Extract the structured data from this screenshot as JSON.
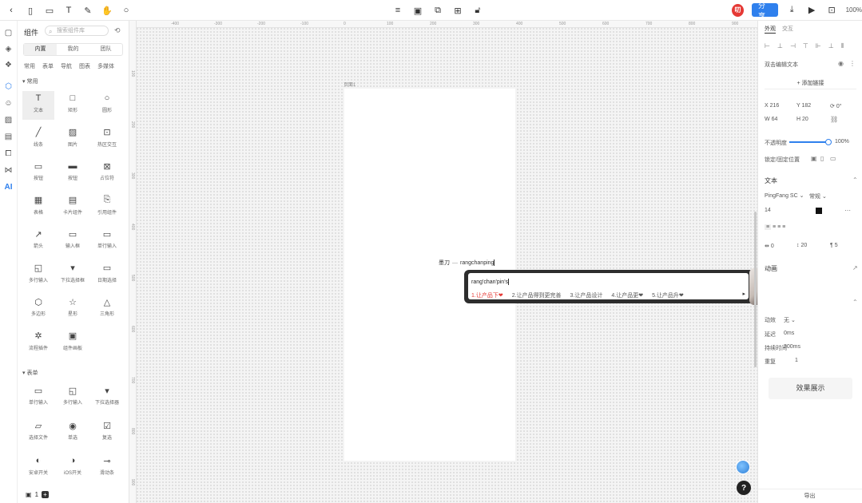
{
  "toolbar": {
    "zoom": "100%",
    "share_label": "分享",
    "avatar_text": "叨"
  },
  "left_panel": {
    "title": "组件",
    "search_placeholder": "搜索组件库",
    "segments": [
      "内置",
      "我的",
      "团队"
    ],
    "subtabs": [
      "常用",
      "表单",
      "导航",
      "图表",
      "多媒体"
    ],
    "group_basic": "▾ 常用",
    "group_form": "▾ 表单",
    "basic_items": [
      {
        "label": "文本",
        "icon": "text-icon"
      },
      {
        "label": "矩形",
        "icon": "rectangle-icon"
      },
      {
        "label": "圆形",
        "icon": "circle-icon"
      },
      {
        "label": "线条",
        "icon": "line-icon"
      },
      {
        "label": "图片",
        "icon": "image-icon"
      },
      {
        "label": "热区交互",
        "icon": "hotspot-icon"
      },
      {
        "label": "按钮",
        "icon": "button-icon"
      },
      {
        "label": "按钮",
        "icon": "button-filled-icon"
      },
      {
        "label": "占位符",
        "icon": "placeholder-icon"
      },
      {
        "label": "表格",
        "icon": "table-icon"
      },
      {
        "label": "卡片组件",
        "icon": "card-icon"
      },
      {
        "label": "引用组件",
        "icon": "reference-icon"
      },
      {
        "label": "箭头",
        "icon": "arrow-icon"
      },
      {
        "label": "输入框",
        "icon": "input-icon"
      },
      {
        "label": "单行输入",
        "icon": "single-input-icon"
      },
      {
        "label": "多行输入",
        "icon": "multiline-icon"
      },
      {
        "label": "下拉选择框",
        "icon": "dropdown-icon"
      },
      {
        "label": "日期选择",
        "icon": "date-icon"
      },
      {
        "label": "多边形",
        "icon": "polygon-icon"
      },
      {
        "label": "星形",
        "icon": "star-icon"
      },
      {
        "label": "三角形",
        "icon": "triangle-icon"
      },
      {
        "label": "流程插件",
        "icon": "pinwheel-icon"
      },
      {
        "label": "组件画板",
        "icon": "artboard-icon"
      }
    ],
    "form_items": [
      {
        "label": "单行输入",
        "icon": "single-input-icon"
      },
      {
        "label": "多行输入",
        "icon": "multiline-icon"
      },
      {
        "label": "下拉选择器",
        "icon": "dropdown-icon"
      },
      {
        "label": "选择文件",
        "icon": "folder-icon"
      },
      {
        "label": "单选",
        "icon": "radio-icon"
      },
      {
        "label": "复选",
        "icon": "checkbox-icon"
      },
      {
        "label": "安卓开关",
        "icon": "toggle-icon"
      },
      {
        "label": "iOS开关",
        "icon": "ios-toggle-icon"
      },
      {
        "label": "滑动条",
        "icon": "slider-icon"
      }
    ],
    "footer_count": "1"
  },
  "canvas": {
    "page_label": "页面1",
    "ruler_h": [
      "-400",
      "-300",
      "-200",
      "-100",
      "0",
      "100",
      "200",
      "300",
      "400",
      "500",
      "600",
      "700",
      "800",
      "900"
    ],
    "ruler_v": [
      "100",
      "200",
      "300",
      "400",
      "500",
      "600",
      "700",
      "800",
      "900"
    ],
    "text_prefix": "墨刀",
    "text_sep": "—",
    "text_typed": "rangchanping"
  },
  "ime": {
    "input": "rang'chan'pin's",
    "candidates": [
      "1.让产品下❤",
      "2.让产品得到更完善",
      "3.让产品设计",
      "4.让产品更❤",
      "5.让产品升❤"
    ],
    "next": "▸"
  },
  "inspector": {
    "tabs": [
      "外观",
      "交互"
    ],
    "section_rich": "双击编辑文本",
    "link_btn": "+ 添加链接",
    "x_label": "X",
    "x_val": "216",
    "y_label": "Y",
    "y_val": "182",
    "rot_val": "0°",
    "w_label": "W",
    "w_val": "64",
    "h_label": "H",
    "h_val": "20",
    "opacity_label": "不透明度",
    "opacity_val": "100%",
    "fit_label": "锁定/固定位置",
    "text_section": "文本",
    "font_family": "PingFang SC",
    "font_weight": "常规",
    "font_size": "14",
    "spacing_vals": [
      "0",
      "20",
      "5"
    ],
    "anim_section": "动画",
    "anim_rows": [
      {
        "label": "动效",
        "val": "无"
      },
      {
        "label": "延迟",
        "val": "0ms"
      },
      {
        "label": "持续时间",
        "val": "300ms"
      },
      {
        "label": "重复",
        "val": "1"
      }
    ],
    "effect_btn": "效果展示",
    "footer": "导出"
  },
  "colors": {
    "accent": "#2f80ed",
    "candidate_highlight": "#e53935",
    "ime_frame": "#2d2d2d"
  }
}
